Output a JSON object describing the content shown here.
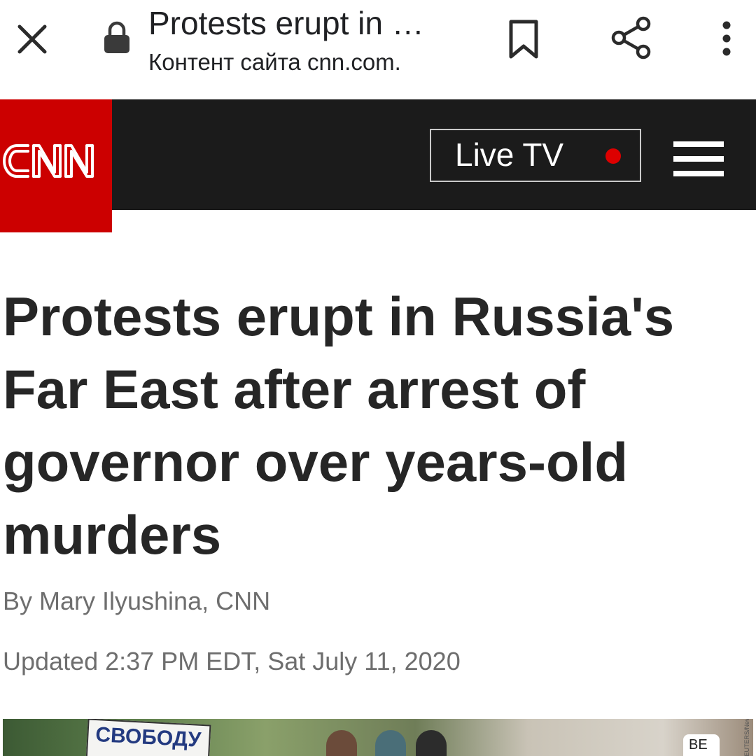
{
  "browser_bar": {
    "title": "Protests erupt in …",
    "subtitle": "Контент сайта cnn.com.",
    "icons": [
      "close-icon",
      "lock-icon",
      "bookmark-icon",
      "share-icon",
      "more-vert-icon"
    ]
  },
  "cnn_header": {
    "logo_text": "CNN",
    "live_tv_label": "Live TV",
    "colors": {
      "brand_red": "#cc0000",
      "header_bg": "#1b1b1b",
      "live_dot": "#dd0000"
    }
  },
  "article": {
    "headline": "Protests erupt in Russia's Far East after arrest of governor over years-old murders",
    "byline": "By Mary Ilyushina, CNN",
    "updated": "Updated 2:37 PM EDT, Sat July 11, 2020"
  },
  "hero_image": {
    "sign_text": "СВОБОДУ",
    "shirt_text": "BE",
    "credit_text": "REUTERS/Newsroom"
  }
}
